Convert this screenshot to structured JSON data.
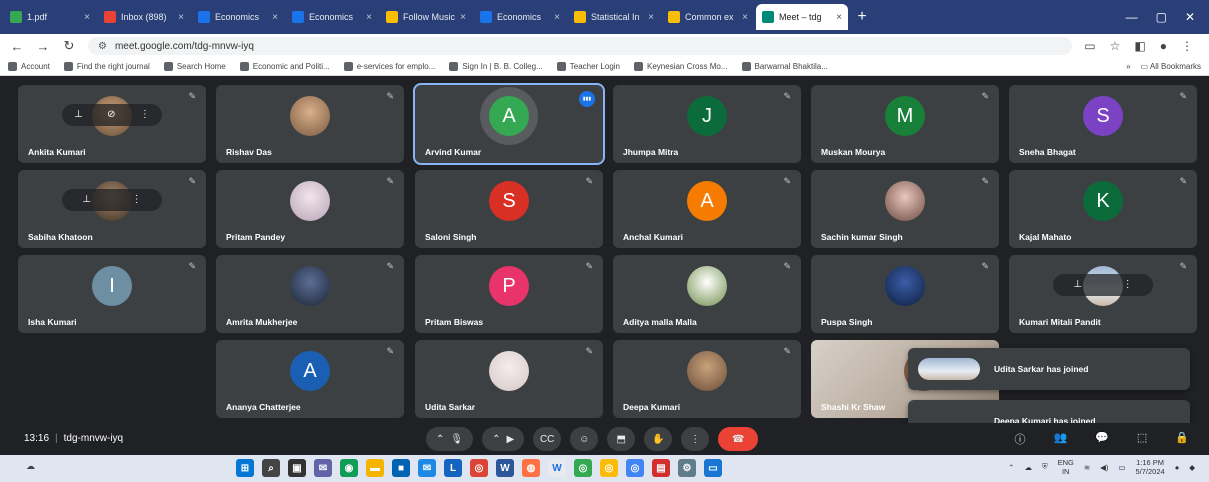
{
  "browser": {
    "tabs": [
      {
        "label": "1.pdf",
        "color": "#34a853"
      },
      {
        "label": "Inbox (898)",
        "color": "#ea4335"
      },
      {
        "label": "Economics",
        "color": "#1a73e8"
      },
      {
        "label": "Economics",
        "color": "#1a73e8"
      },
      {
        "label": "Follow Music",
        "color": "#fbbc04"
      },
      {
        "label": "Economics",
        "color": "#1a73e8"
      },
      {
        "label": "Statistical In",
        "color": "#fbbc04"
      },
      {
        "label": "Common ex",
        "color": "#fbbc04"
      },
      {
        "label": "Meet – tdg",
        "color": "#00897b",
        "active": true
      }
    ],
    "url": "meet.google.com/tdg-mnvw-iyq",
    "bookmarks": [
      "Account",
      "Find the right journal",
      "Search Home",
      "Economic and Politi...",
      "e-services for emplo...",
      "Sign In | B. B. Colleg...",
      "Teacher Login",
      "Keynesian Cross Mo...",
      "Barwarnal Bhaktila..."
    ],
    "all_bookmarks": "All Bookmarks"
  },
  "meet": {
    "participants": [
      {
        "name": "Ankita Kumari",
        "type": "photo",
        "hover": true
      },
      {
        "name": "Rishav Das",
        "type": "photo"
      },
      {
        "name": "Arvind Kumar",
        "type": "letter",
        "letter": "A",
        "color": "#34a853",
        "speaking": true
      },
      {
        "name": "Jhumpa Mitra",
        "type": "letter",
        "letter": "J",
        "color": "#0b6b3a"
      },
      {
        "name": "Muskan Mourya",
        "type": "letter",
        "letter": "M",
        "color": "#188038"
      },
      {
        "name": "Sneha Bhagat",
        "type": "letter",
        "letter": "S",
        "color": "#7b42c4"
      },
      {
        "name": "Sabiha Khatoon",
        "type": "photo",
        "hover": true
      },
      {
        "name": "Pritam Pandey",
        "type": "photo"
      },
      {
        "name": "Saloni Singh",
        "type": "letter",
        "letter": "S",
        "color": "#d93025"
      },
      {
        "name": "Anchal Kumari",
        "type": "letter",
        "letter": "A",
        "color": "#f57c00"
      },
      {
        "name": "Sachin kumar Singh",
        "type": "photo"
      },
      {
        "name": "Kajal Mahato",
        "type": "letter",
        "letter": "K",
        "color": "#0b6b3a"
      },
      {
        "name": "Isha Kumari",
        "type": "letter",
        "letter": "I",
        "color": "#6e8ea1"
      },
      {
        "name": "Amrita Mukherjee",
        "type": "photo"
      },
      {
        "name": "Pritam Biswas",
        "type": "letter",
        "letter": "P",
        "color": "#e8336b"
      },
      {
        "name": "Aditya malla Malla",
        "type": "photo"
      },
      {
        "name": "Puspa Singh",
        "type": "photo"
      },
      {
        "name": "Kumari Mitali Pandit",
        "type": "photo",
        "hover": true
      },
      {
        "name": "Ananya Chatterjee",
        "type": "letter",
        "letter": "A",
        "color": "#1a5fb4"
      },
      {
        "name": "Udita Sarkar",
        "type": "photo"
      },
      {
        "name": "Deepa Kumari",
        "type": "photo"
      },
      {
        "name": "Shashi Kr Shaw",
        "type": "video"
      }
    ],
    "toasts": [
      {
        "text": "Udita Sarkar has joined"
      },
      {
        "text": "Deepa Kumari has joined"
      }
    ],
    "time": "13:16",
    "meeting_code": "tdg-mnvw-iyq"
  },
  "taskbar": {
    "lang": "ENG",
    "region": "IN",
    "time": "1:16 PM",
    "date": "5/7/2024"
  }
}
